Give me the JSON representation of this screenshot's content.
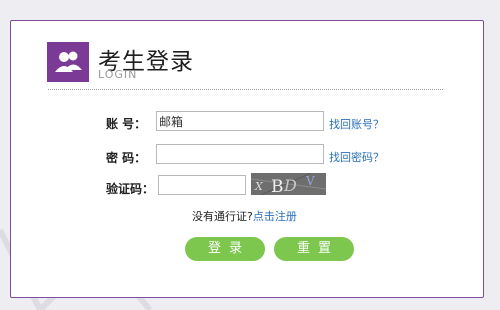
{
  "header": {
    "title": "考生登录",
    "subtitle": "LOGIN",
    "logo_icon": "users-icon"
  },
  "form": {
    "account_label": "账  号：",
    "account_value": "邮箱",
    "forgot_account": "找回账号？",
    "password_label": "密  码：",
    "password_value": "",
    "forgot_password": "找回密码？",
    "captcha_label": "验证码：",
    "captcha_value": "",
    "captcha_text": "XBDV"
  },
  "register": {
    "prefix": "没有通行证?",
    "link": "点击注册"
  },
  "buttons": {
    "login": "登录",
    "reset": "重置"
  },
  "colors": {
    "accent": "#7c3a97",
    "button": "#7dc74f",
    "link": "#2a6fb8"
  }
}
